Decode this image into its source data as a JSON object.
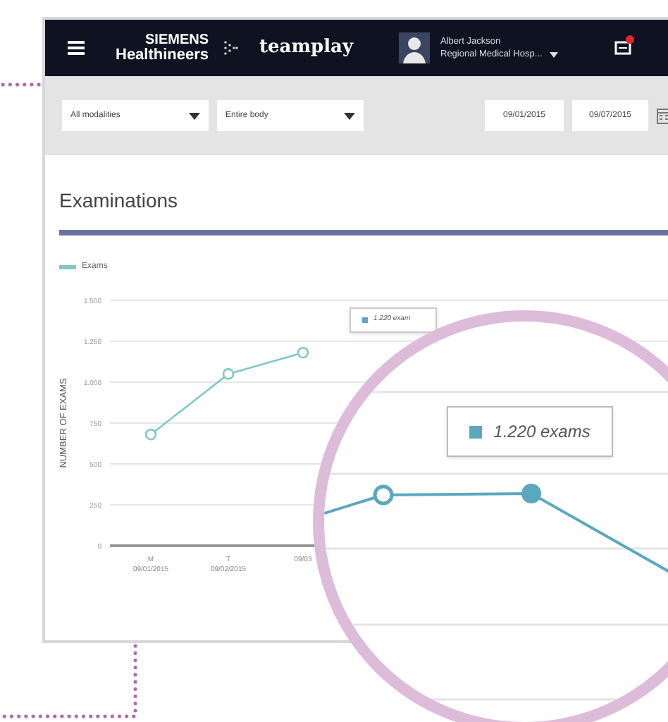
{
  "header": {
    "brand_top": "SIEMENS",
    "brand_bottom": "Healthineers",
    "product": "teamplay",
    "user_name": "Albert Jackson",
    "user_org": "Regional Medical Hosp..."
  },
  "filters": {
    "dropdowns": [
      "All modalities",
      "Entire body"
    ],
    "date_from": "09/01/2015",
    "date_to": "09/07/2015"
  },
  "section": {
    "title": "Examinations"
  },
  "chart": {
    "tooltip": "1.220 exam",
    "chart_data": {
      "type": "line",
      "ylabel": "NUMBER OF EXAMS",
      "categories": [
        "M 09/01/2015",
        "T 09/02/2015",
        "09/03"
      ],
      "grid": true,
      "series": [
        {
          "name": "Exams",
          "color": "#7fc8c8",
          "marker": "circle",
          "values": [
            680,
            1050,
            1180
          ]
        }
      ],
      "ylim": [
        0,
        1500
      ],
      "yticks": [
        {
          "value": 0,
          "label": "0"
        },
        {
          "value": 250,
          "label": "250"
        },
        {
          "value": 500,
          "label": "500"
        },
        {
          "value": 750,
          "label": "750"
        },
        {
          "value": 1000,
          "label": "1.000"
        },
        {
          "value": 1250,
          "label": "1.250"
        },
        {
          "value": 1500,
          "label": "1.500"
        }
      ]
    }
  },
  "magnifier": {
    "tooltip": "1.220 exams"
  }
}
